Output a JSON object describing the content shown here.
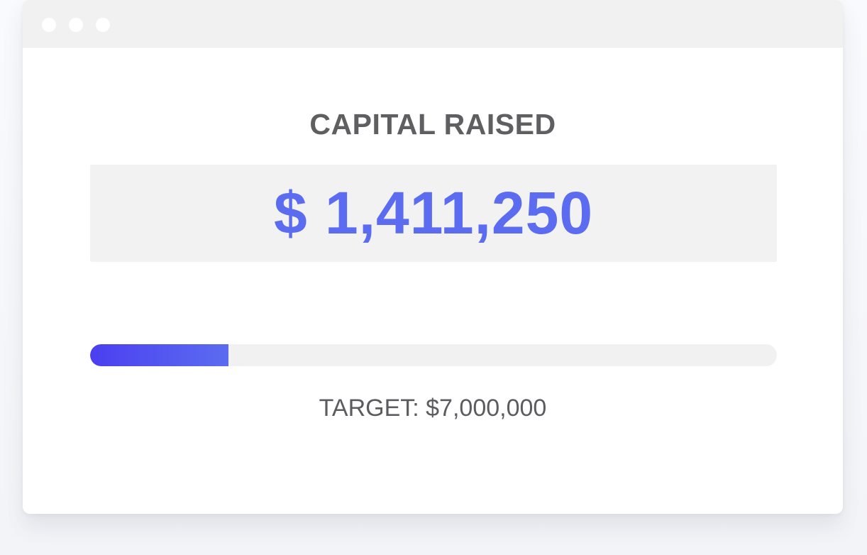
{
  "widget": {
    "heading": "CAPITAL RAISED",
    "amount": "$ 1,411,250",
    "target_text": "TARGET: $7,000,000",
    "progress_fraction": 0.2016
  },
  "colors": {
    "accent": "#5b6cf0",
    "progress_fill_start": "#4b3ff0",
    "progress_fill_end": "#5b6cf0",
    "heading": "#5f5f62",
    "track": "#f1f1f2"
  }
}
